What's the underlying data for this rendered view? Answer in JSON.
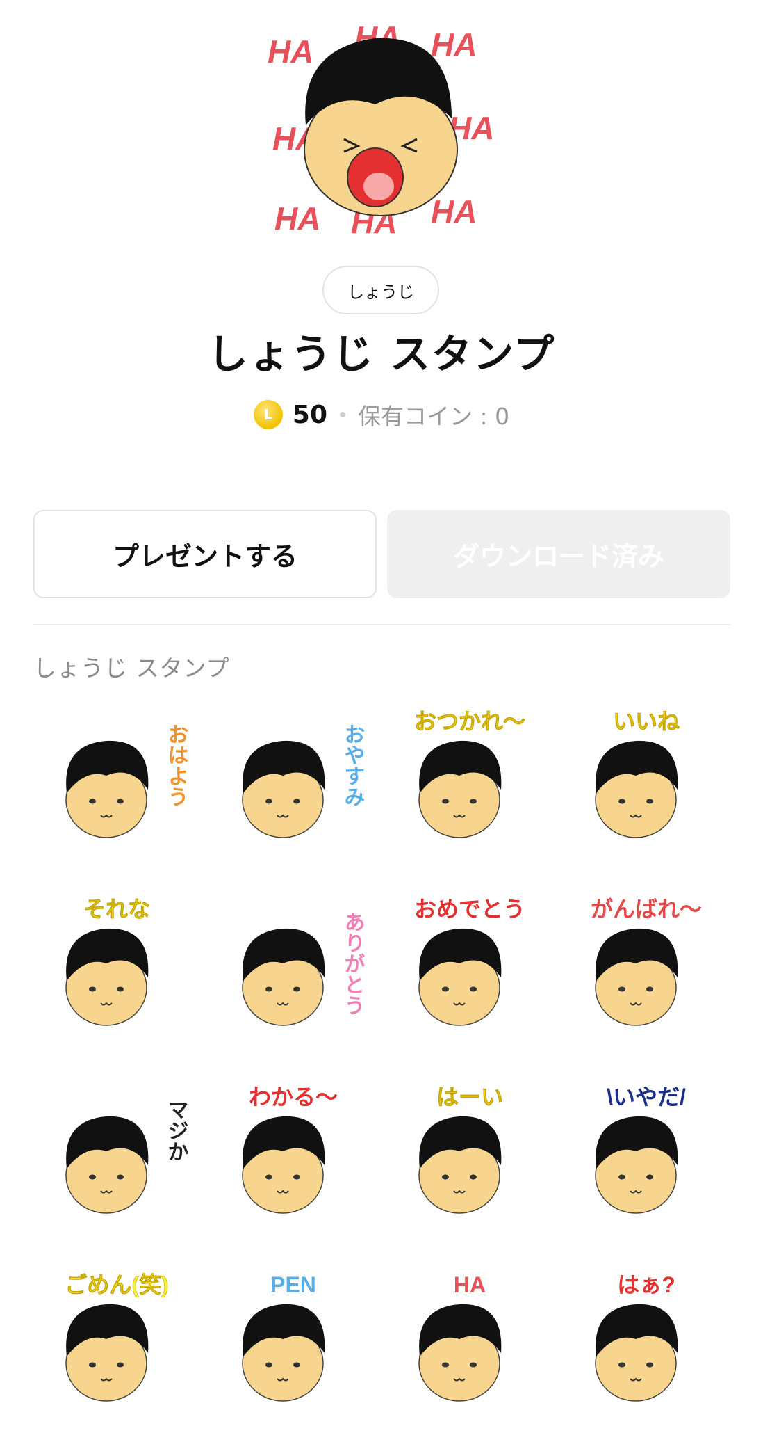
{
  "header": {
    "creator": "しょうじ",
    "title": "しょうじ スタンプ",
    "coin_symbol": "L",
    "price": "50",
    "owned_coins": "保有コイン : 0"
  },
  "actions": {
    "gift_label": "プレゼントする",
    "download_label": "ダウンロード済み"
  },
  "section": {
    "label": "しょうじ スタンプ"
  },
  "hero_text": "HA",
  "stickers": [
    {
      "text": "おはよう",
      "color": "#f0922b"
    },
    {
      "text": "おやすみ",
      "color": "#5aaee8"
    },
    {
      "text": "おつかれ〜",
      "color": "#f2d12b"
    },
    {
      "text": "いいね",
      "color": "#f2d12b"
    },
    {
      "text": "それな",
      "color": "#e8e22a"
    },
    {
      "text": "ありがとう",
      "color": "#f07fb6"
    },
    {
      "text": "おめでとう",
      "color": "#e43030"
    },
    {
      "text": "がんばれ〜",
      "color": "#e34a4a"
    },
    {
      "text": "マジか",
      "color": "#222222"
    },
    {
      "text": "わかる〜",
      "color": "#e43030"
    },
    {
      "text": "はーい",
      "color": "#f2d12b"
    },
    {
      "text": "\\いやだ/",
      "color": "#1a2f8a"
    },
    {
      "text": "ごめん(笑)",
      "color": "#f2ec3a"
    },
    {
      "text": "PEN",
      "color": "#5aaee8"
    },
    {
      "text": "HA",
      "color": "#e8505a"
    },
    {
      "text": "はぁ?",
      "color": "#e43030"
    }
  ],
  "colors": {
    "hair": "#111111",
    "skin": "#f7d58e",
    "accent_red": "#e8505a"
  }
}
